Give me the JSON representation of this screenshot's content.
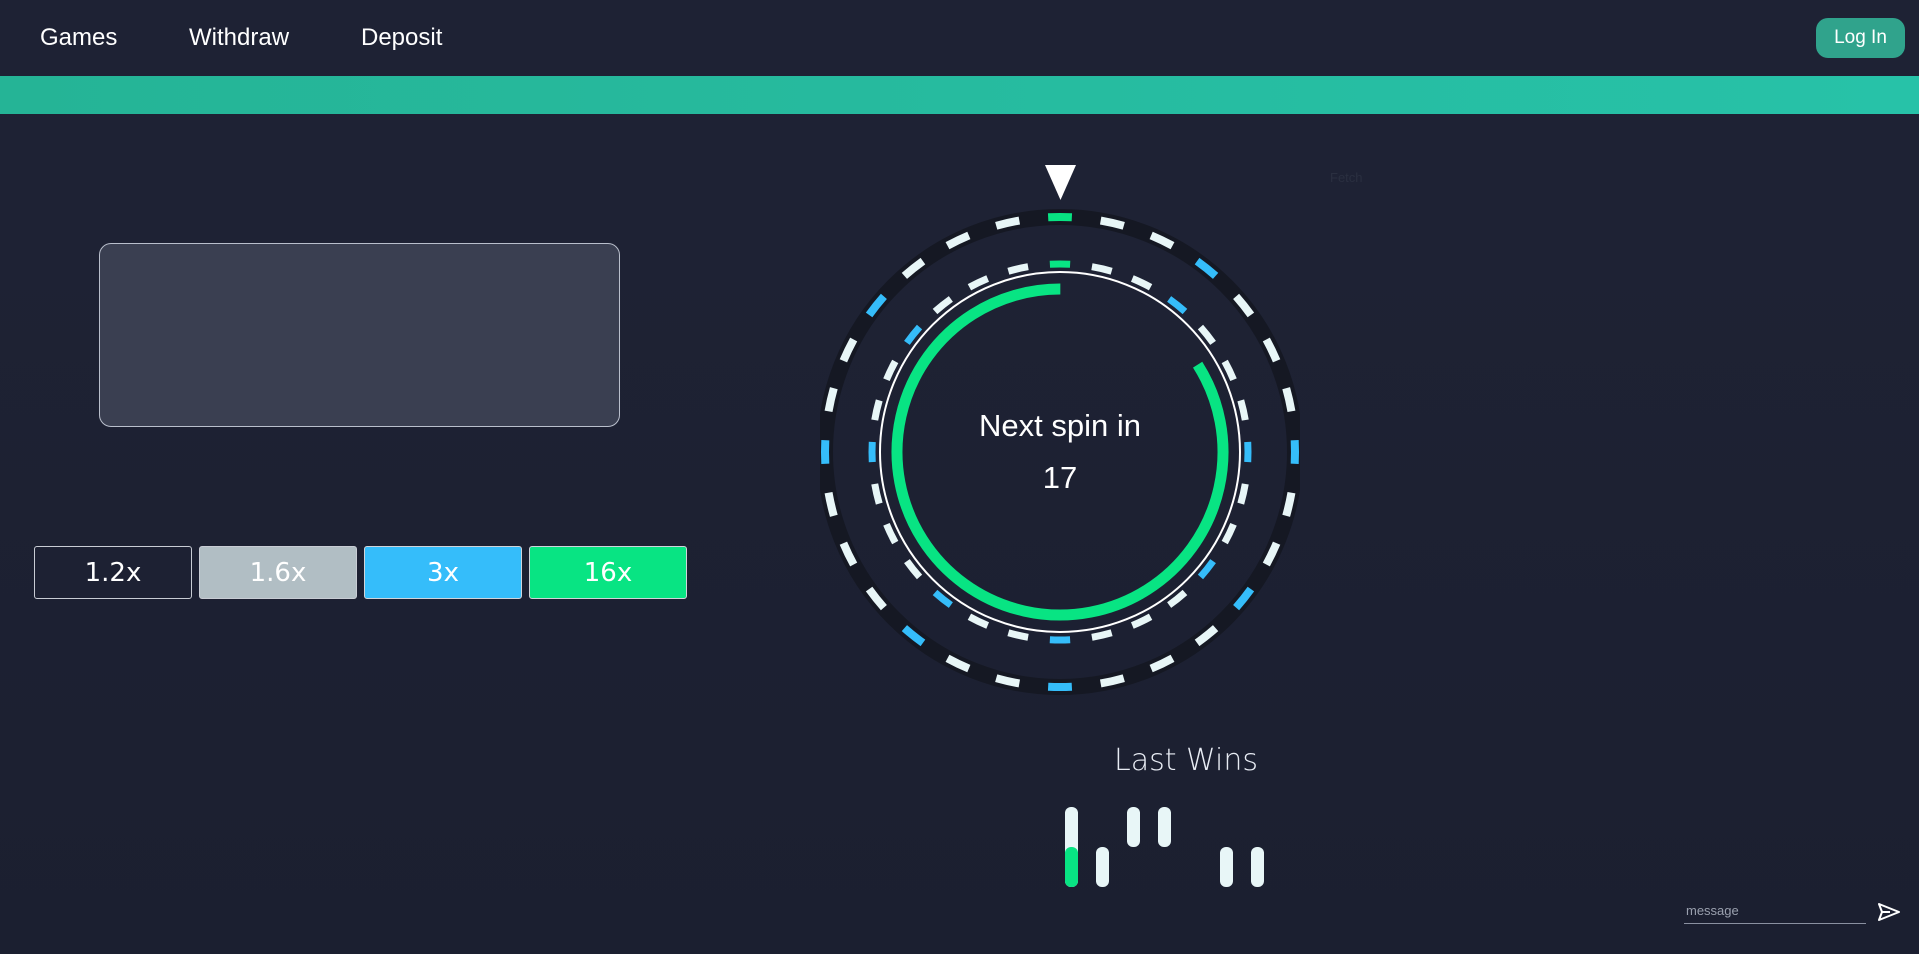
{
  "header": {
    "nav": [
      "Games",
      "Withdraw",
      "Deposit"
    ],
    "login_label": "Log In"
  },
  "multipliers": [
    {
      "label": "1.2x",
      "color": "#1d2133"
    },
    {
      "label": "1.6x",
      "color": "#b1bec4"
    },
    {
      "label": "3x",
      "color": "#35bdfa"
    },
    {
      "label": "16x",
      "color": "#08e483"
    }
  ],
  "wheel": {
    "title": "Next spin in",
    "countdown": "17",
    "timer_progress": 0.84,
    "faint_label": "Fetch",
    "icons": {
      "pointer": "pointer-triangle-icon"
    },
    "colors": {
      "white": "#e8f6f7",
      "blue": "#35bdfa",
      "green": "#08e483"
    }
  },
  "last_wins": {
    "title": "Last Wins",
    "results": [
      "green",
      "white",
      "white",
      "white",
      "none",
      "white",
      "white"
    ]
  },
  "chat": {
    "placeholder": "message",
    "send_icon": "send-icon"
  }
}
